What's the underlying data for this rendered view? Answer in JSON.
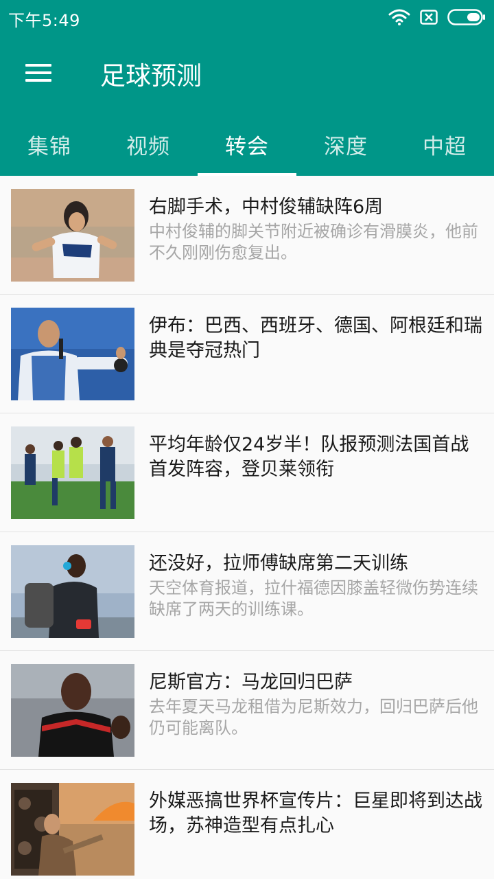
{
  "status_bar": {
    "time": "下午5:49"
  },
  "toolbar": {
    "title": "足球预测"
  },
  "tabs": [
    {
      "label": "集锦",
      "active": false
    },
    {
      "label": "视频",
      "active": false
    },
    {
      "label": "转会",
      "active": true
    },
    {
      "label": "深度",
      "active": false
    },
    {
      "label": "中超",
      "active": false
    }
  ],
  "news": [
    {
      "title": "右脚手术，中村俊辅缺阵6周",
      "desc": "中村俊辅的脚关节附近被确诊有滑膜炎，他前不久刚刚伤愈复出。"
    },
    {
      "title": "伊布：巴西、西班牙、德国、阿根廷和瑞典是夺冠热门",
      "desc": ""
    },
    {
      "title": "平均年龄仅24岁半！队报预测法国首战首发阵容，登贝莱领衔",
      "desc": ""
    },
    {
      "title": "还没好，拉师傅缺席第二天训练",
      "desc": "天空体育报道，拉什福德因膝盖轻微伤势连续缺席了两天的训练课。"
    },
    {
      "title": "尼斯官方：马龙回归巴萨",
      "desc": "去年夏天马龙租借为尼斯效力，回归巴萨后他仍可能离队。"
    },
    {
      "title": "外媒恶搞世界杯宣传片：巨星即将到达战场，苏神造型有点扎心",
      "desc": ""
    }
  ],
  "colors": {
    "primary": "#009688",
    "title_text": "#1a1a1a",
    "desc_text": "#a6a6a6"
  }
}
